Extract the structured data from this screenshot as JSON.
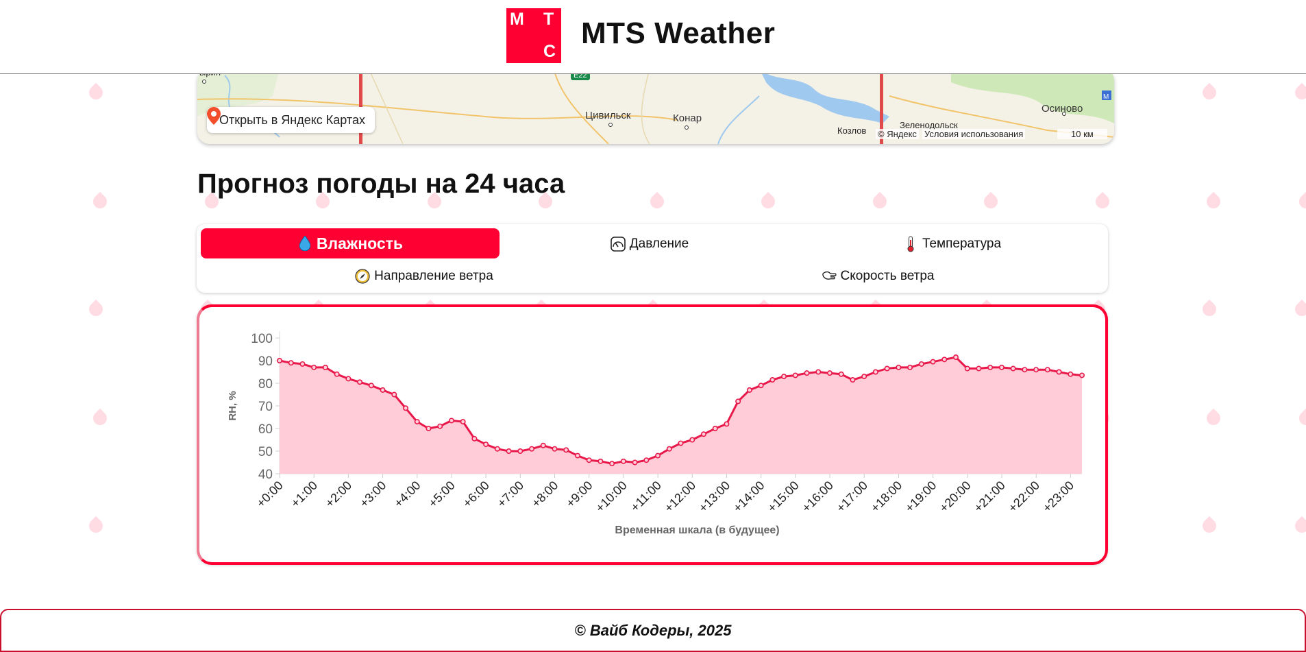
{
  "header": {
    "logo_letters": [
      "М",
      "Т",
      "С"
    ],
    "brand": "MTS Weather",
    "accent": "#ff0032"
  },
  "map": {
    "open_button": "Открыть в Яндекс Картах",
    "places": [
      "ырин",
      "Цивильск",
      "Конар",
      "Осиново",
      "Козлов",
      "Зеленодольск"
    ],
    "road": "E22",
    "copyright": "© Яндекс",
    "terms": "Условия использования",
    "scale": "10 км"
  },
  "forecast": {
    "title": "Прогноз погоды на 24 часа",
    "tabs": [
      {
        "label": "Влажность",
        "icon": "droplet-icon",
        "active": true
      },
      {
        "label": "Давление",
        "icon": "gauge-icon",
        "active": false
      },
      {
        "label": "Температура",
        "icon": "thermometer-icon",
        "active": false
      },
      {
        "label": "Направление ветра",
        "icon": "compass-icon",
        "active": false
      },
      {
        "label": "Скорость ветра",
        "icon": "wind-icon",
        "active": false
      }
    ]
  },
  "chart_data": {
    "type": "area",
    "title": "",
    "xlabel": "Временная шкала (в будущее)",
    "ylabel": "RH, %",
    "ylim": [
      40,
      100
    ],
    "yticks": [
      40,
      50,
      60,
      70,
      80,
      90,
      100
    ],
    "xtick_labels": [
      "+0:00",
      "+1:00",
      "+2:00",
      "+3:00",
      "+4:00",
      "+5:00",
      "+6:00",
      "+7:00",
      "+8:00",
      "+9:00",
      "+10:00",
      "+11:00",
      "+12:00",
      "+13:00",
      "+14:00",
      "+15:00",
      "+16:00",
      "+17:00",
      "+18:00",
      "+19:00",
      "+20:00",
      "+21:00",
      "+22:00",
      "+23:00"
    ],
    "x_step_hours": 0.3333,
    "series": [
      {
        "color": "#e8194a",
        "fill": "#ffc9d5",
        "values": [
          90,
          89,
          88.5,
          87,
          87,
          84,
          82,
          80.5,
          79,
          77,
          75,
          69,
          63,
          60,
          61,
          63.5,
          63,
          55.5,
          53,
          51,
          50,
          50,
          51,
          52.5,
          51,
          50.5,
          48,
          46,
          45.5,
          44.5,
          45.5,
          45,
          46,
          48,
          51,
          53.5,
          55,
          57.5,
          60,
          62,
          72,
          77,
          79,
          81.5,
          83,
          83.5,
          84.5,
          85,
          84.5,
          84,
          81.5,
          83,
          85,
          86.5,
          87,
          87,
          88.5,
          89.5,
          90.5,
          91.5,
          86.5,
          86.5,
          87,
          87,
          86.5,
          86,
          86,
          86,
          85,
          84,
          83.5
        ]
      }
    ],
    "grid": false,
    "legend": "none"
  },
  "footer": {
    "text": "© Вайб Кодеры, 2025"
  }
}
